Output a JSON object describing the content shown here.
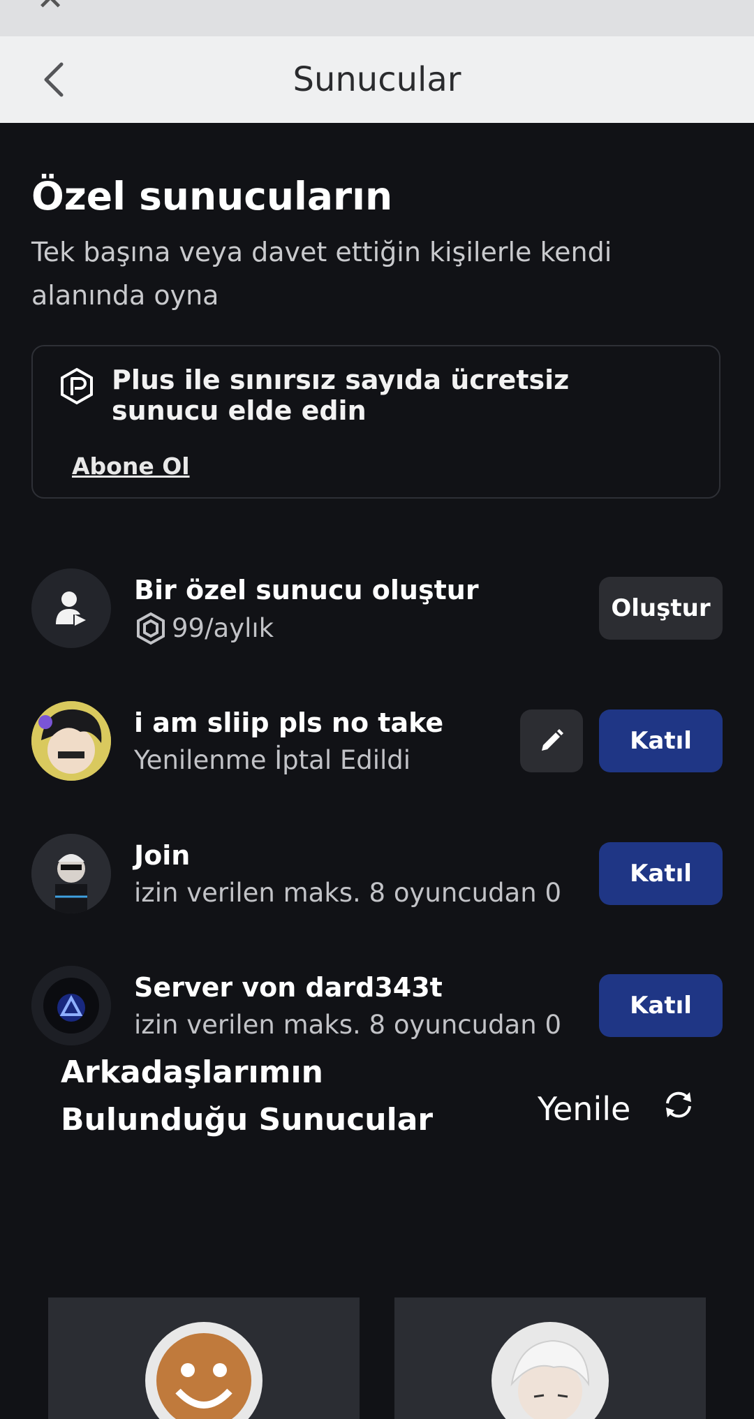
{
  "nav": {
    "title": "Sunucular"
  },
  "section": {
    "heading": "Özel sunucuların",
    "subtitle": "Tek başına veya davet ettiğin kişilerle kendi alanında oyna"
  },
  "plus_card": {
    "text": "Plus ile sınırsız sayıda ücretsiz sunucu elde edin",
    "link": "Abone Ol"
  },
  "create": {
    "title": "Bir özel sunucu oluştur",
    "price": "99/aylık",
    "button": "Oluştur"
  },
  "servers": [
    {
      "name": "i am sliip pls no take",
      "status": "Yenilenme İptal Edildi",
      "button": "Katıl"
    },
    {
      "name": "Join",
      "status": "izin verilen maks. 8 oyuncudan 0",
      "button": "Katıl"
    },
    {
      "name": "Server von dard343t",
      "status": "izin verilen maks. 8 oyuncudan 0",
      "button": "Katıl"
    }
  ],
  "friends": {
    "title": "Arkadaşlarımın Bulunduğu Sunucular",
    "refresh": "Yenile"
  },
  "colors": {
    "accent_blue": "#1f3685",
    "background": "#111216"
  }
}
